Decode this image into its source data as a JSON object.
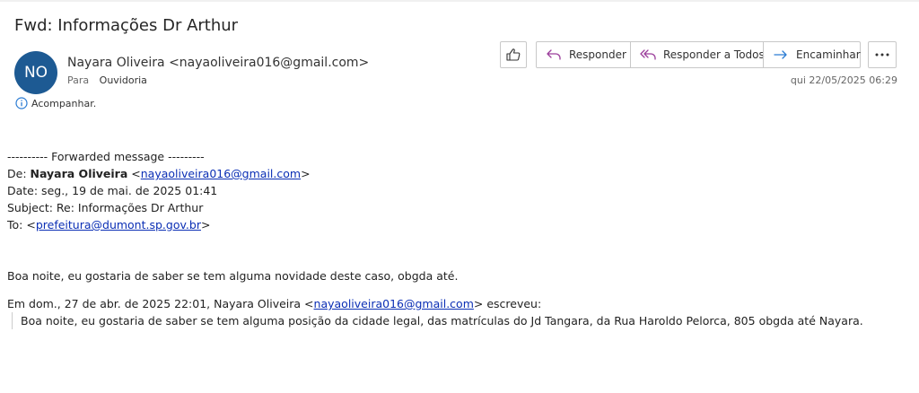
{
  "subject": "Fwd: Informações Dr Arthur",
  "sender": {
    "initials": "NO",
    "display": "Nayara Oliveira <nayaoliveira016@gmail.com>",
    "to_label": "Para",
    "to_value": "Ouvidoria",
    "avatar_color": "#1d5a93"
  },
  "follow_up": "Acompanhar.",
  "actions": {
    "reply": "Responder",
    "reply_all": "Responder a Todos",
    "forward": "Encaminhar"
  },
  "received": "qui 22/05/2025 06:29",
  "forwarded": {
    "header": "---------- Forwarded message ---------",
    "from_label": "De: ",
    "from_name": "Nayara Oliveira",
    "lt": " <",
    "gt": ">",
    "from_email": "nayaoliveira016@gmail.com",
    "date": "Date: seg., 19 de mai. de 2025 01:41",
    "subject": "Subject: Re: Informações Dr Arthur",
    "to_label": "To: <",
    "to_email": "prefeitura@dumont.sp.gov.br"
  },
  "message": "Boa noite,  eu gostaria de saber se tem alguma novidade deste caso, obgda até.",
  "quoted": {
    "intro_prefix": "Em dom., 27 de abr. de 2025 22:01, Nayara Oliveira <",
    "intro_email": "nayaoliveira016@gmail.com",
    "intro_suffix": "> escreveu:",
    "text": "Boa noite,  eu gostaria de saber se tem alguma posição da cidade legal, das matrículas  do Jd Tangara,  da Rua Haroldo Pelorca, 805 obgda até Nayara."
  },
  "colors": {
    "accent_icon": "#9b3e9b",
    "forward_icon": "#2b7cd3",
    "link": "#0b2fb5"
  }
}
